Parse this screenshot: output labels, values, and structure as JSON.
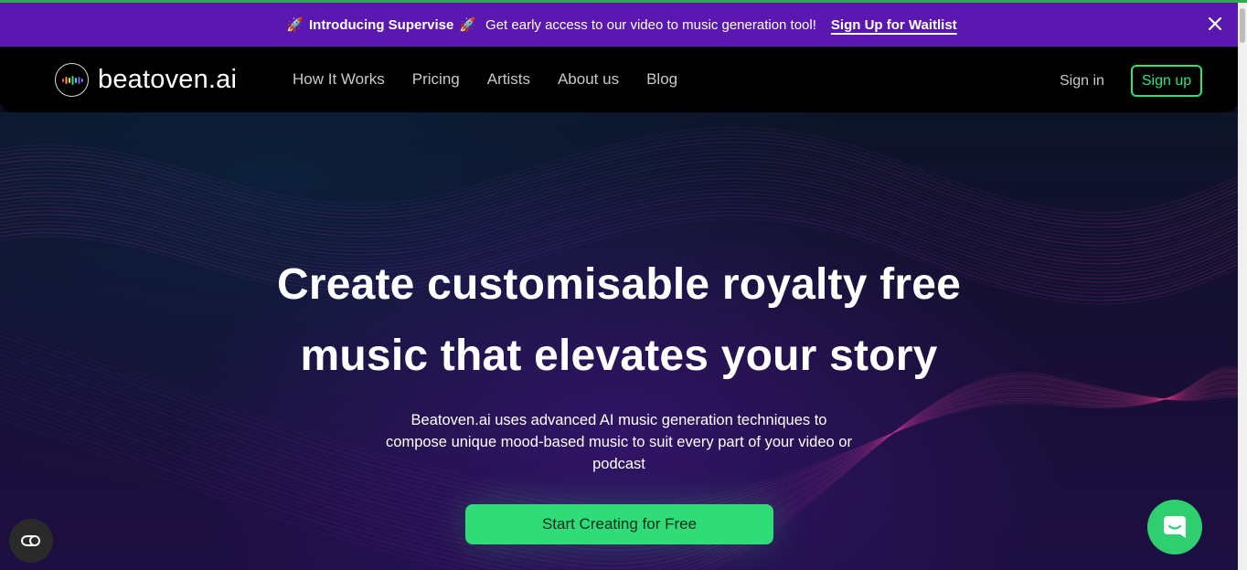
{
  "announcement": {
    "rocket_icon": "🚀",
    "title": "Introducing Supervise",
    "description": "Get early access to our video to music generation tool!",
    "cta": "Sign Up for Waitlist",
    "background": "#5b18b0"
  },
  "nav": {
    "logo_text": "beatoven.ai",
    "links": [
      "How It Works",
      "Pricing",
      "Artists",
      "About us",
      "Blog"
    ],
    "sign_in": "Sign in",
    "sign_up": "Sign up",
    "accent": "#2de37c"
  },
  "hero": {
    "headline_line1": "Create customisable royalty free",
    "headline_line2": "music that elevates your story",
    "subtext_line1": "Beatoven.ai uses advanced AI music generation techniques to",
    "subtext_line2": "compose unique mood-based music to suit every part of your video or",
    "subtext_line3": "podcast",
    "cta": "Start Creating for Free",
    "cta_color": "#2fdc78"
  },
  "widgets": {
    "cookie_icon": "cookie-settings-icon",
    "chat_icon": "chat-bubble-icon"
  }
}
